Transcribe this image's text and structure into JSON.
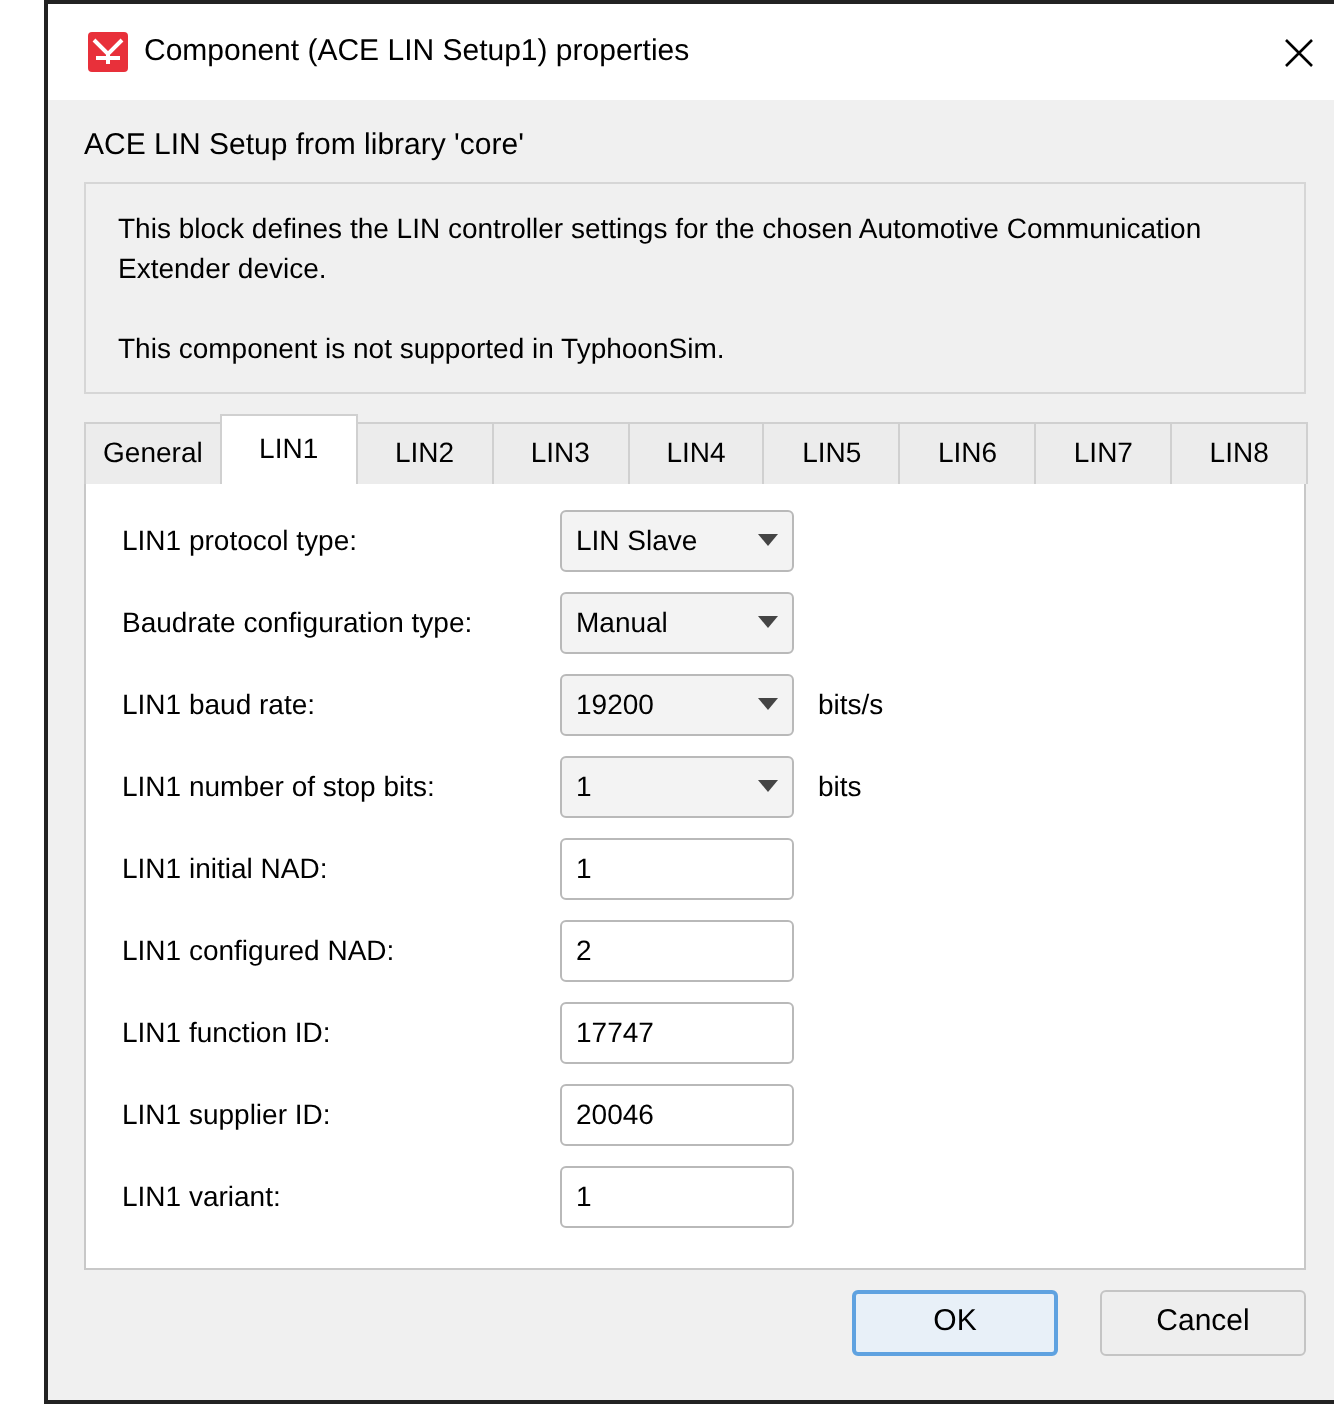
{
  "window": {
    "title": "Component (ACE LIN Setup1) properties"
  },
  "subtitle": "ACE LIN Setup from library 'core'",
  "description": [
    "This block defines the LIN controller settings for the chosen Automotive Communication Extender device.",
    "This component is not supported in TyphoonSim."
  ],
  "tabs": [
    {
      "label": "General",
      "selected": false
    },
    {
      "label": "LIN1",
      "selected": true
    },
    {
      "label": "LIN2",
      "selected": false
    },
    {
      "label": "LIN3",
      "selected": false
    },
    {
      "label": "LIN4",
      "selected": false
    },
    {
      "label": "LIN5",
      "selected": false
    },
    {
      "label": "LIN6",
      "selected": false
    },
    {
      "label": "LIN7",
      "selected": false
    },
    {
      "label": "LIN8",
      "selected": false
    }
  ],
  "fields": [
    {
      "label": "LIN1 protocol type:",
      "kind": "dropdown",
      "value": "LIN Slave"
    },
    {
      "label": "Baudrate configuration type:",
      "kind": "dropdown",
      "value": "Manual"
    },
    {
      "label": "LIN1 baud rate:",
      "kind": "dropdown",
      "value": "19200",
      "unit": "bits/s"
    },
    {
      "label": "LIN1 number of stop bits:",
      "kind": "dropdown",
      "value": "1",
      "unit": "bits"
    },
    {
      "label": "LIN1 initial NAD:",
      "kind": "text",
      "value": "1"
    },
    {
      "label": "LIN1 configured NAD:",
      "kind": "text",
      "value": "2"
    },
    {
      "label": "LIN1 function ID:",
      "kind": "text",
      "value": "17747"
    },
    {
      "label": "LIN1 supplier ID:",
      "kind": "text",
      "value": "20046"
    },
    {
      "label": "LIN1 variant:",
      "kind": "text",
      "value": "1"
    }
  ],
  "buttons": [
    {
      "label": "OK",
      "default": true
    },
    {
      "label": "Cancel",
      "default": false
    }
  ]
}
